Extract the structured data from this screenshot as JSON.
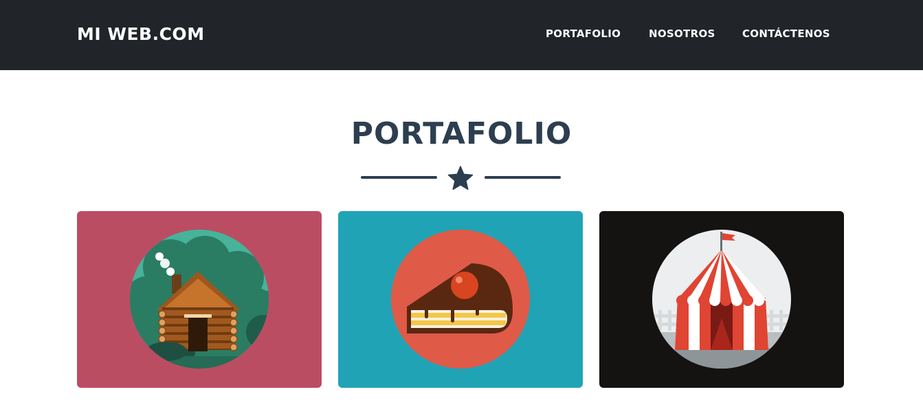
{
  "navbar": {
    "brand": "MI WEB.COM",
    "links": [
      "PORTAFOLIO",
      "NOSOTROS",
      "CONTÁCTENOS"
    ]
  },
  "portfolio": {
    "title": "PORTAFOLIO",
    "divider_icon": "star-icon",
    "items": [
      {
        "icon": "log-cabin-icon",
        "bg": "#bb4d63",
        "circle": "#2a6e5a"
      },
      {
        "icon": "cake-slice-icon",
        "bg": "#21a3b6",
        "circle": "#e05a48"
      },
      {
        "icon": "circus-tent-icon",
        "bg": "#151212",
        "circle": "#eceeef"
      }
    ]
  },
  "colors": {
    "navbar": "#212529",
    "heading": "#2c3e50",
    "white": "#ffffff"
  }
}
